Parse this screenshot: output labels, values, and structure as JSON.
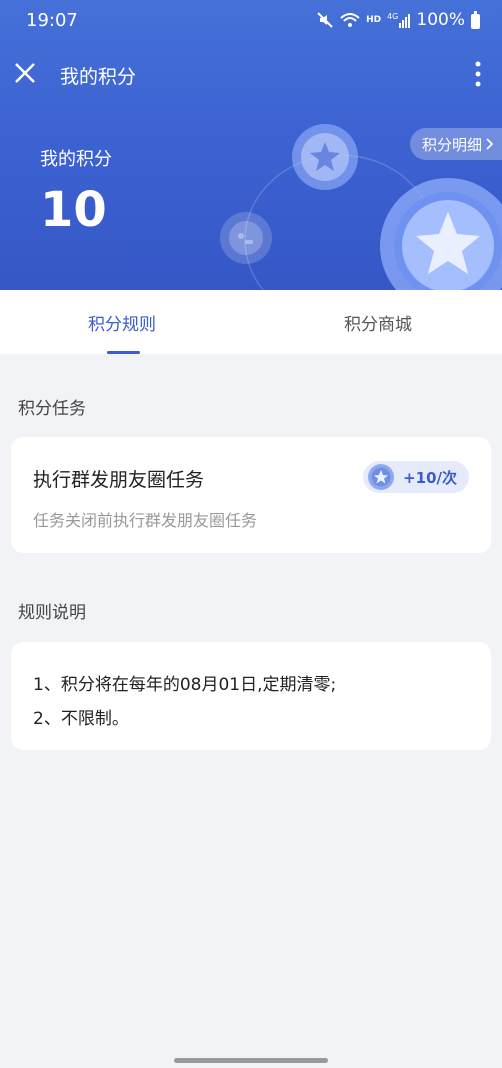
{
  "status_bar": {
    "time": "19:07",
    "network": "HD",
    "signal": "4G",
    "battery": "100%"
  },
  "nav": {
    "title": "我的积分"
  },
  "summary": {
    "label": "我的积分",
    "points": "10",
    "detail_link": "积分明细"
  },
  "tabs": [
    {
      "label": "积分规则",
      "active": true
    },
    {
      "label": "积分商城",
      "active": false
    }
  ],
  "tasks_section": {
    "title": "积分任务",
    "task": {
      "title": "执行群发朋友圈任务",
      "desc": "任务关闭前执行群发朋友圈任务",
      "reward": "+10/次"
    }
  },
  "rules_section": {
    "title": "规则说明",
    "lines": [
      "1、积分将在每年的08月01日,定期清零;",
      "2、不限制。"
    ]
  },
  "colors": {
    "brand": "#3a5ccc",
    "header": "#4068d6",
    "background": "#f2f3f7"
  }
}
